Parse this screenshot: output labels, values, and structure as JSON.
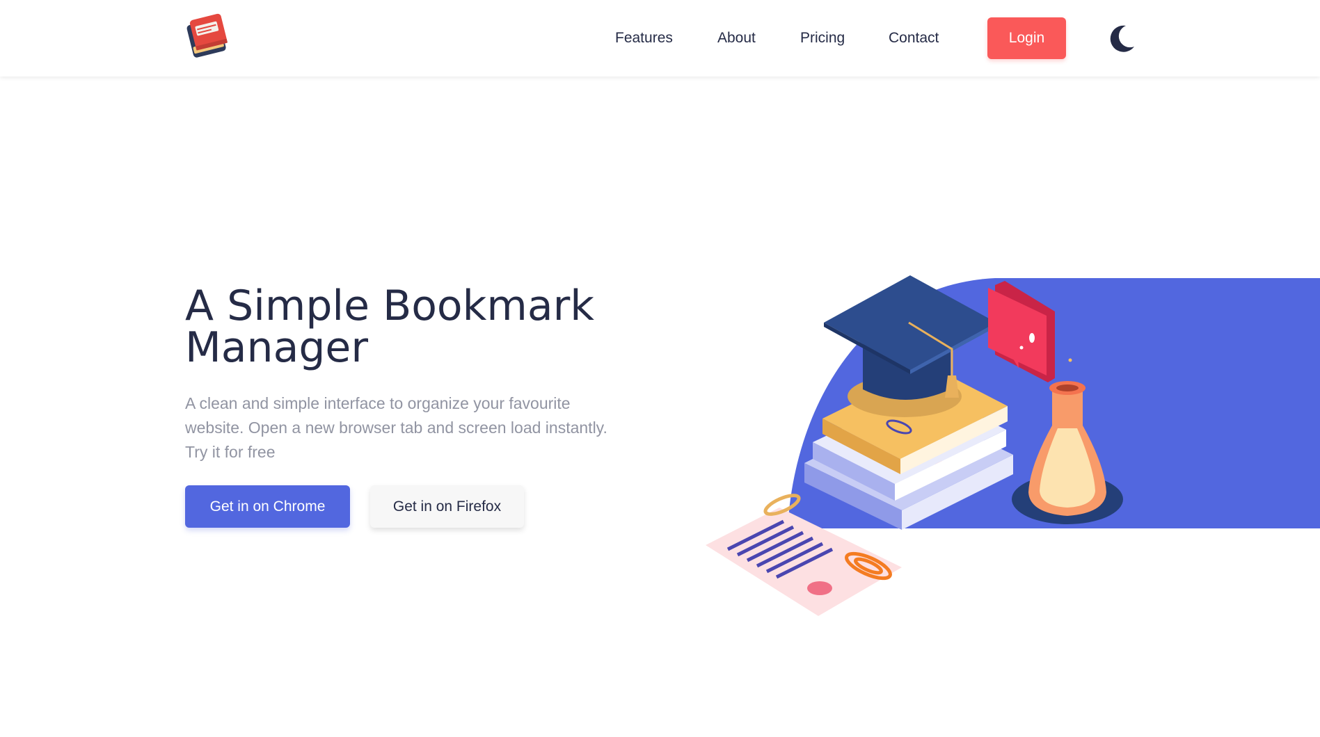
{
  "header": {
    "logo_icon": "bookmark-book-logo",
    "nav": [
      {
        "label": "Features"
      },
      {
        "label": "About"
      },
      {
        "label": "Pricing"
      },
      {
        "label": "Contact"
      }
    ],
    "login_label": "Login",
    "theme_icon": "moon-icon"
  },
  "hero": {
    "title": "A Simple Bookmark Manager",
    "description": "A clean and simple interface to organize your favourite website. Open a new browser tab and screen load instantly. Try it for free",
    "chrome_button": "Get in on Chrome",
    "firefox_button": "Get in on Firefox",
    "illustration": "graduation-books-illustration"
  },
  "colors": {
    "primary_blue": "#5267df",
    "accent_red": "#fa5959",
    "dark_navy": "#252b46",
    "muted_gray": "#9194a2"
  }
}
